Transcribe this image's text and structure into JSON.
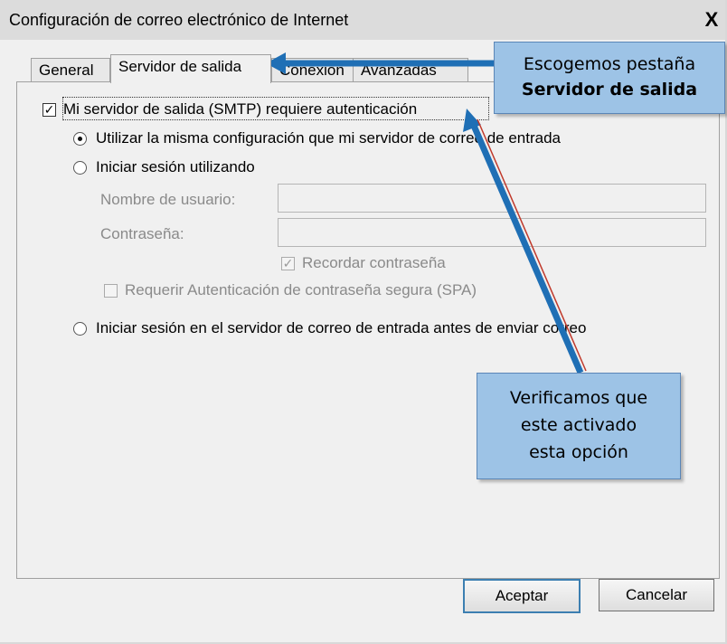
{
  "window": {
    "title": "Configuración de correo electrónico de Internet",
    "close_label": "X"
  },
  "tabs": [
    {
      "label": "General",
      "active": false
    },
    {
      "label": "Servidor de salida",
      "active": true
    },
    {
      "label": "Conexión",
      "active": false
    },
    {
      "label": "Avanzadas",
      "active": false
    }
  ],
  "outgoing": {
    "smtp_auth_label": "Mi servidor de salida (SMTP) requiere autenticación",
    "smtp_auth_checked": true,
    "same_settings_label": "Utilizar la misma configuración que mi servidor de correo de entrada",
    "logon_using_label": "Iniciar sesión utilizando",
    "username_label": "Nombre de usuario:",
    "username_value": "",
    "password_label": "Contraseña:",
    "password_value": "",
    "remember_password_label": "Recordar contraseña",
    "remember_password_checked": true,
    "spa_label": "Requerir Autenticación de contraseña segura (SPA)",
    "spa_checked": false,
    "logon_incoming_label": "Iniciar sesión en el servidor de correo de entrada antes de enviar correo"
  },
  "buttons": {
    "ok_label": "Aceptar",
    "cancel_label": "Cancelar"
  },
  "annotations": {
    "tab_callout_line1": "Escogemos pestaña",
    "tab_callout_line2": "Servidor de salida",
    "check_callout_line1": "Verificamos que",
    "check_callout_line2": "este activado",
    "check_callout_line3": "esta opción",
    "callout_color": "#9dc3e6",
    "arrow_color": "#1f6fb5"
  }
}
